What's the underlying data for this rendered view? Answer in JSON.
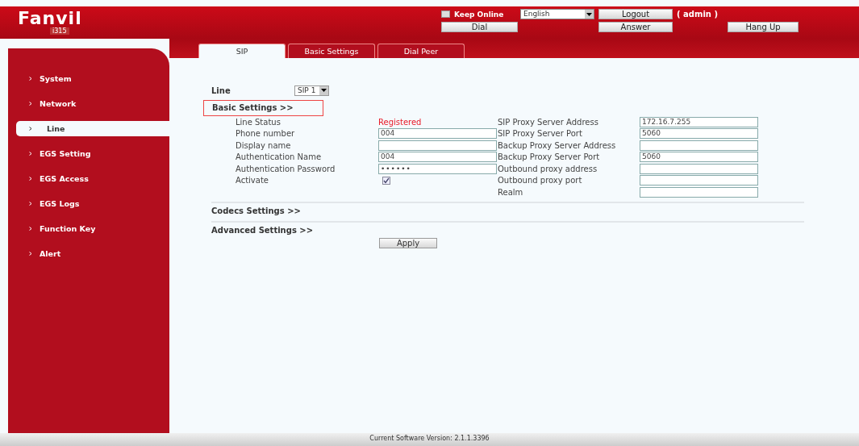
{
  "header": {
    "brand": "Fanvil",
    "model": "i315",
    "keep_online": {
      "label": "Keep Online",
      "checked": false
    },
    "language": "English",
    "logout": "Logout",
    "user": "( admin )",
    "dial": "Dial",
    "answer": "Answer",
    "hang_up": "Hang Up"
  },
  "tabs": [
    {
      "label": "SIP",
      "selected": true
    },
    {
      "label": "Basic Settings",
      "selected": false
    },
    {
      "label": "Dial Peer",
      "selected": false
    }
  ],
  "sidebar": {
    "items": [
      {
        "label": "System",
        "selected": false
      },
      {
        "label": "Network",
        "selected": false
      },
      {
        "label": "Line",
        "selected": true
      },
      {
        "label": "EGS Setting",
        "selected": false
      },
      {
        "label": "EGS Access",
        "selected": false
      },
      {
        "label": "EGS Logs",
        "selected": false
      },
      {
        "label": "Function Key",
        "selected": false
      },
      {
        "label": "Alert",
        "selected": false
      }
    ]
  },
  "line_selector": {
    "label": "Line",
    "value": "SIP 1"
  },
  "basic_settings": {
    "title": "Basic Settings >>",
    "highlighted": true,
    "left_fields": [
      {
        "label": "Line Status",
        "kind": "status",
        "value": "Registered"
      },
      {
        "label": "Phone number",
        "kind": "input",
        "value": "004"
      },
      {
        "label": "Display name",
        "kind": "input"
      },
      {
        "label": "Authentication Name",
        "kind": "input",
        "value": "004"
      },
      {
        "label": "Authentication Password",
        "kind": "password",
        "value": "••••••"
      },
      {
        "label": "Activate",
        "kind": "checkbox",
        "checked": true
      }
    ],
    "right_fields": [
      {
        "label": "SIP Proxy Server Address",
        "kind": "input",
        "value": "172.16.7.255"
      },
      {
        "label": "SIP Proxy Server Port",
        "kind": "input",
        "value": "5060"
      },
      {
        "label": "Backup Proxy Server Address",
        "kind": "input"
      },
      {
        "label": "Backup Proxy Server Port",
        "kind": "input",
        "value": "5060"
      },
      {
        "label": "Outbound proxy address",
        "kind": "input"
      },
      {
        "label": "Outbound proxy port",
        "kind": "input"
      },
      {
        "label": "Realm",
        "kind": "input"
      }
    ]
  },
  "codecs_settings": "Codecs Settings >>",
  "advanced_settings": "Advanced Settings >>",
  "apply": "Apply",
  "footer": "Current Software Version: 2.1.1.3396"
}
